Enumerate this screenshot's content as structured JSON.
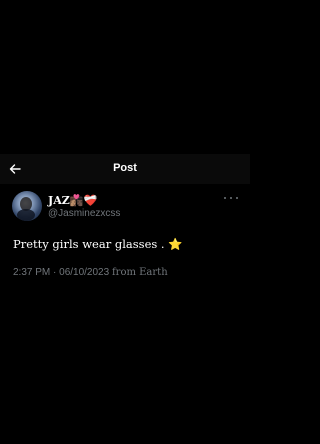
{
  "header": {
    "back_icon": "arrow-left-icon",
    "title": "Post"
  },
  "post": {
    "author_name": "JAZ👩🏽‍❤️‍💋‍👨🏿❤️‍🩹",
    "author_handle": "@Jasminezxcss",
    "more_icon": "more-horizontal-icon",
    "text": "Pretty girls wear glasses . ⭐",
    "timestamp": "2:37 PM · 06/10/2023",
    "location": "from Earth"
  },
  "colors": {
    "background": "#000000",
    "header_bg": "#0a0a0a",
    "text_primary": "#ffffff",
    "text_secondary": "#71767b"
  }
}
